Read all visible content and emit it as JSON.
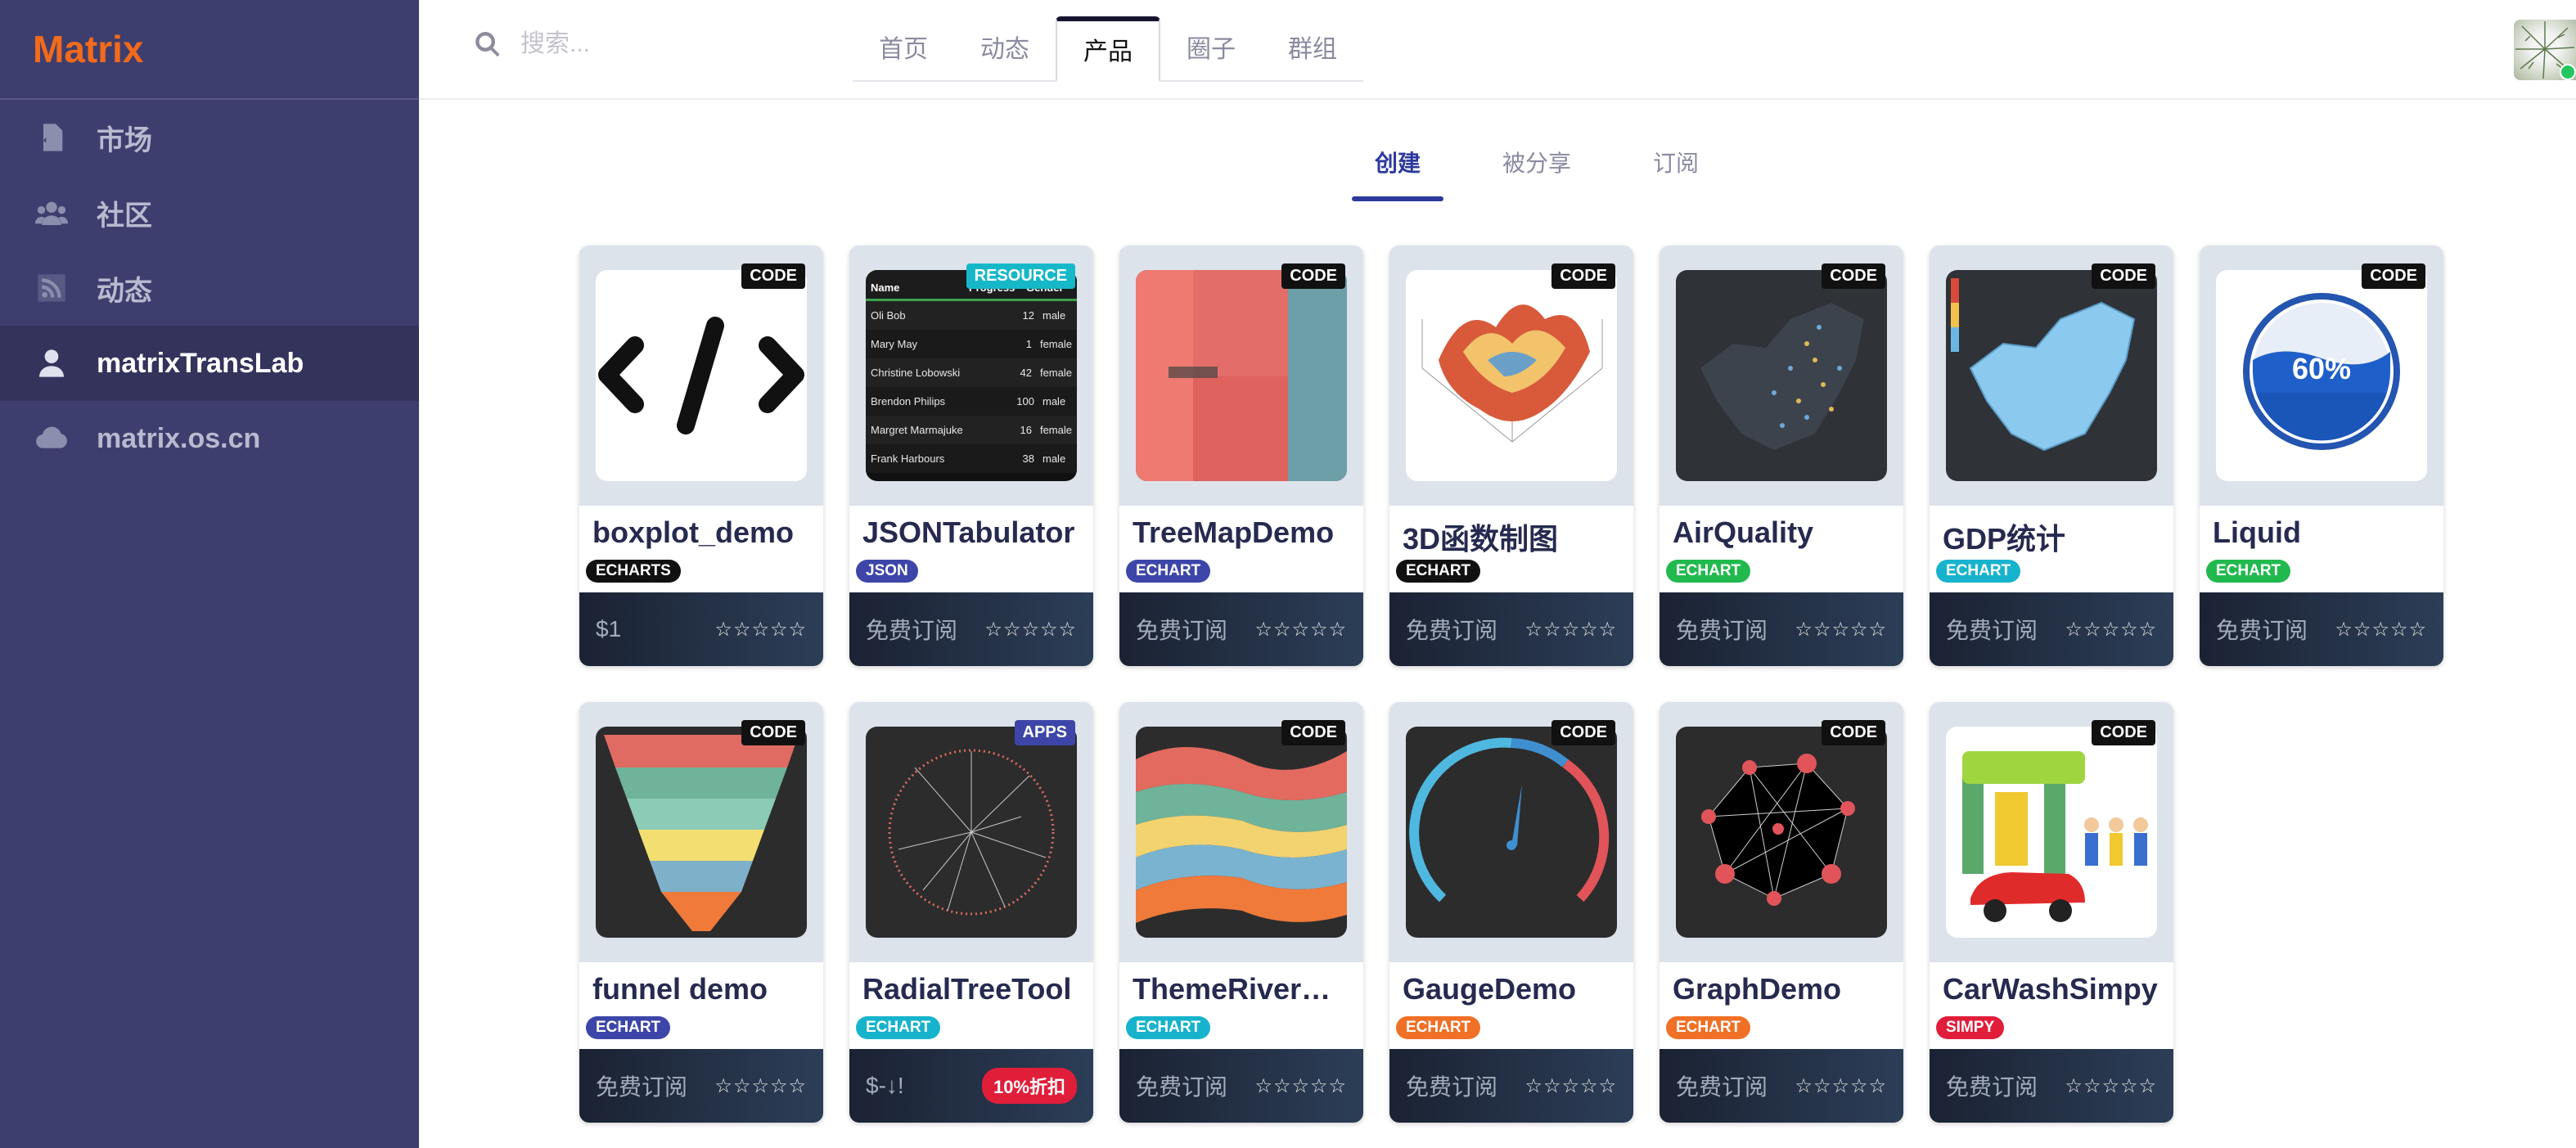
{
  "brand": "Matrix",
  "sidebar": {
    "items": [
      {
        "label": "市场",
        "icon": "code-file-icon"
      },
      {
        "label": "社区",
        "icon": "users-icon"
      },
      {
        "label": "动态",
        "icon": "rss-icon"
      },
      {
        "label": "matrixTransLab",
        "icon": "user-icon",
        "active": true
      },
      {
        "label": "matrix.os.cn",
        "icon": "cloud-icon"
      }
    ]
  },
  "search": {
    "placeholder": "搜索..."
  },
  "top_tabs": [
    "首页",
    "动态",
    "产品",
    "圈子",
    "群组"
  ],
  "top_tabs_active": "产品",
  "sub_tabs": [
    "创建",
    "被分享",
    "订阅"
  ],
  "sub_tabs_active": "创建",
  "colors": {
    "accent": "#2d3a9c",
    "brand": "#f26a1b",
    "sidebar": "#3e3e6e"
  },
  "stars": "☆☆☆☆☆",
  "cards": [
    {
      "name": "boxplot_demo",
      "type": "CODE",
      "tag": "ECHARTS",
      "tag_color": "#111111",
      "price": "$1"
    },
    {
      "name": "JSONTabulator",
      "type": "RESOURCE",
      "tag": "JSON",
      "tag_color": "#3d46a8",
      "price": "免费订阅"
    },
    {
      "name": "TreeMapDemo",
      "type": "CODE",
      "tag": "ECHART",
      "tag_color": "#3d46a8",
      "price": "免费订阅"
    },
    {
      "name": "3D函数制图",
      "type": "CODE",
      "tag": "ECHART",
      "tag_color": "#111111",
      "price": "免费订阅"
    },
    {
      "name": "AirQuality",
      "type": "CODE",
      "tag": "ECHART",
      "tag_color": "#21b94e",
      "price": "免费订阅"
    },
    {
      "name": "GDP统计",
      "type": "CODE",
      "tag": "ECHART",
      "tag_color": "#17b3cc",
      "price": "免费订阅"
    },
    {
      "name": "Liquid",
      "type": "CODE",
      "tag": "ECHART",
      "tag_color": "#21b94e",
      "price": "免费订阅"
    },
    {
      "name": "funnel demo",
      "type": "CODE",
      "tag": "ECHART",
      "tag_color": "#3d46a8",
      "price": "免费订阅"
    },
    {
      "name": "RadialTreeTool",
      "type": "APPS",
      "tag": "ECHART",
      "tag_color": "#17b3cc",
      "price": "$-↓!",
      "discount": "10%折扣"
    },
    {
      "name": "ThemeRiverDe...",
      "type": "CODE",
      "tag": "ECHART",
      "tag_color": "#17b3cc",
      "price": "免费订阅"
    },
    {
      "name": "GaugeDemo",
      "type": "CODE",
      "tag": "ECHART",
      "tag_color": "#f07025",
      "price": "免费订阅"
    },
    {
      "name": "GraphDemo",
      "type": "CODE",
      "tag": "ECHART",
      "tag_color": "#f07025",
      "price": "免费订阅"
    },
    {
      "name": "CarWashSimpy",
      "type": "CODE",
      "tag": "SIMPY",
      "tag_color": "#e01e3a",
      "price": "免费订阅"
    }
  ],
  "thumbs": {
    "json_table": {
      "headers": [
        "Name",
        "Progress",
        "Gender"
      ],
      "rows": [
        [
          "Oli Bob",
          "12",
          "male"
        ],
        [
          "Mary May",
          "1",
          "female"
        ],
        [
          "Christine Lobowski",
          "42",
          "female"
        ],
        [
          "Brendon Philips",
          "100",
          "male"
        ],
        [
          "Margret Marmajuke",
          "16",
          "female"
        ],
        [
          "Frank Harbours",
          "38",
          "male"
        ]
      ]
    },
    "liquid_value": "60%"
  }
}
